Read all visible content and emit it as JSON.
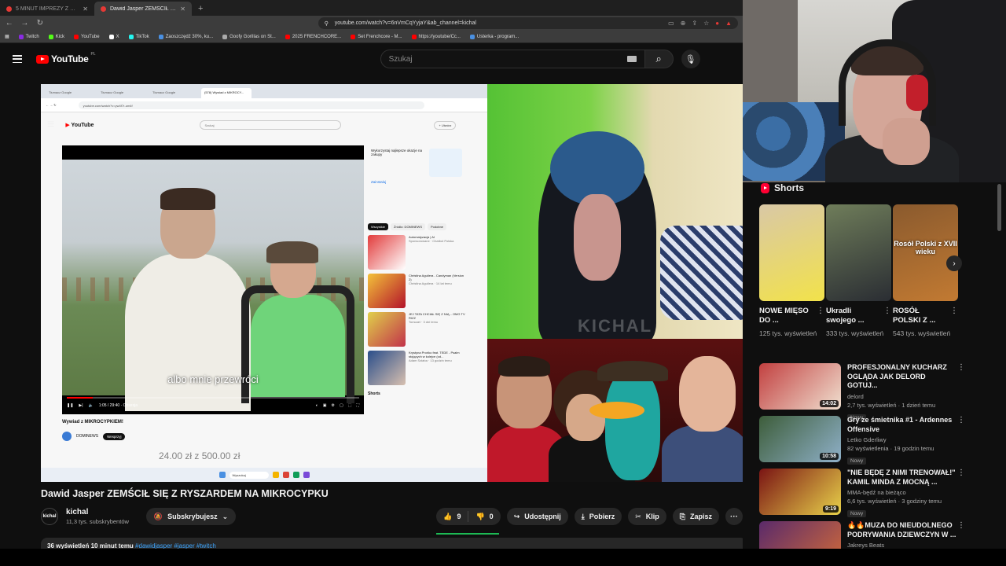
{
  "browser": {
    "tabs": [
      {
        "label": "5 MINUT IMPREZY Z DEMONZEM - Y",
        "active": false
      },
      {
        "label": "Dawid Jasper ZEMŚCIŁ SIĘ Z R",
        "active": true
      }
    ],
    "new_tab": "+",
    "url": "youtube.com/watch?v=6nVmCqYyjaY&ab_channel=kichal",
    "bookmarks": [
      "Twitch",
      "Kick",
      "YouTube",
      "X",
      "TikTok",
      "Zaoszczędź 30%, ku...",
      "Goofy Gorillas on St...",
      "2025 FRENCHCORE...",
      "Set Frenchcore - M...",
      "https://youtube/Cc...",
      "Usterka - program..."
    ]
  },
  "header": {
    "logo_text": "YouTube",
    "country_code": "PL",
    "search_placeholder": "Szukaj"
  },
  "inner_screen": {
    "tabs": [
      "Tłumacz Google",
      "Tłumacz Google",
      "Tłumacz Google",
      "(578) Wywiad z MIKROCY..."
    ],
    "address": "youtube.com/watch?v=yw4f7r-um4f",
    "search_placeholder": "Szukaj",
    "upload_label": "+ Utwórz",
    "subtitle": "albo mnie przewróci",
    "time": "1:05 / 29:40 · Obsesja",
    "title": "Wywiad z MIKROCYPKIEM!",
    "channel": "DOMINEWS",
    "subs_label": "Wesprzyj",
    "money_text": "24.00 zł z 500.00 zł",
    "ad_text": "Wykorzystaj najlepsze okazje na zakupy",
    "ad_cta": "Zainstaluj",
    "chips": [
      "Wszystkie",
      "Źródło: DOMINEWS",
      "Podobne"
    ],
    "recs": [
      {
        "title": "Automatyzacja | AI",
        "meta": "Sponsorowane · Chatbot Polska"
      },
      {
        "title": "Christina Aguilera - Candyman (Version 2)",
        "meta": "Christina Aguilera · 14 lat temu"
      },
      {
        "title": "JEJ TATA CHCIAŁ SIĘ Z NIĄ... OMG TV RIZZ",
        "meta": "Tomcael · 3 dni temu"
      },
      {
        "title": "Krystyna Prońko feat. TEDE - Psalm stojących w kolejce (od...",
        "meta": "Adam Szłaba · 13 godzin temu"
      }
    ],
    "shorts_label": "Shorts",
    "taskbar_search": "Wyszukaj"
  },
  "cam_watermark": "KICHAL",
  "video": {
    "title": "Dawid Jasper ZEMŚCIŁ SIĘ Z RYSZARDEM NA MIKROCYPKU",
    "channel_avatar": "kichal",
    "channel_name": "kichal",
    "subscribers": "11,3 tys. subskrybentów",
    "subscribe_label": "Subskrybujesz",
    "likes": "9",
    "like_ratio": 1.0,
    "dislikes": "0",
    "share_label": "Udostępnij",
    "download_label": "Pobierz",
    "clip_label": "Klip",
    "save_label": "Zapisz",
    "more_label": "···",
    "desc_meta": "36 wyświetleń  10 minut temu",
    "desc_tags": "#dawidjasper #jasper #twitch"
  },
  "sidebar": {
    "shorts_title": "Shorts",
    "shorts": [
      {
        "title": "NOWE MIĘSO DO ...",
        "views": "125 tys. wyświetleń",
        "caption": "",
        "color_a": "#d9c8a6",
        "color_b": "#f2e24a"
      },
      {
        "title": "Ukradli swojego ...",
        "views": "333 tys. wyświetleń",
        "caption": "",
        "color_a": "#6f7d5a",
        "color_b": "#2a2d33"
      },
      {
        "title": "ROSÓŁ POLSKI Z ...",
        "views": "543 tys. wyświetleń",
        "caption": "Rosół Polski z XVII wieku",
        "color_a": "#8a5a2e",
        "color_b": "#c27a32"
      }
    ],
    "recs": [
      {
        "title": "PROFESJONALNY KUCHARZ OGLĄDA JAK DELORD GOTUJ...",
        "channel": "delord",
        "meta": "2,7 tys. wyświetleń · 1 dzień temu",
        "badge": "Nowy",
        "duration": "14:02",
        "color_a": "#c24040",
        "color_b": "#f0e0d0"
      },
      {
        "title": "Gry ze śmietnika #1 - Ardennes Offensive",
        "channel": "Letko Gderliwy",
        "meta": "82 wyświetlenia · 19 godzin temu",
        "badge": "Nowy",
        "duration": "10:58",
        "color_a": "#3d5d3a",
        "color_b": "#8fb0c8"
      },
      {
        "title": "\"NIE BĘDĘ Z NIMI TRENOWAŁ!\" KAMIL MINDA Z MOCNĄ ...",
        "channel": "MMA-będź na bieżąco",
        "meta": "6,6 tys. wyświetleń · 3 godziny temu",
        "badge": "Nowy",
        "duration": "9:19",
        "color_a": "#7a1414",
        "color_b": "#e8d24a"
      },
      {
        "title": "🔥🔥MUZA DO NIEUDOLNEGO PODRYWANIA DZIEWCZYN W ...",
        "channel": "Jakreys Beats",
        "meta": "",
        "badge": "",
        "duration": "",
        "color_a": "#5a2a6a",
        "color_b": "#d06a3a"
      }
    ]
  }
}
